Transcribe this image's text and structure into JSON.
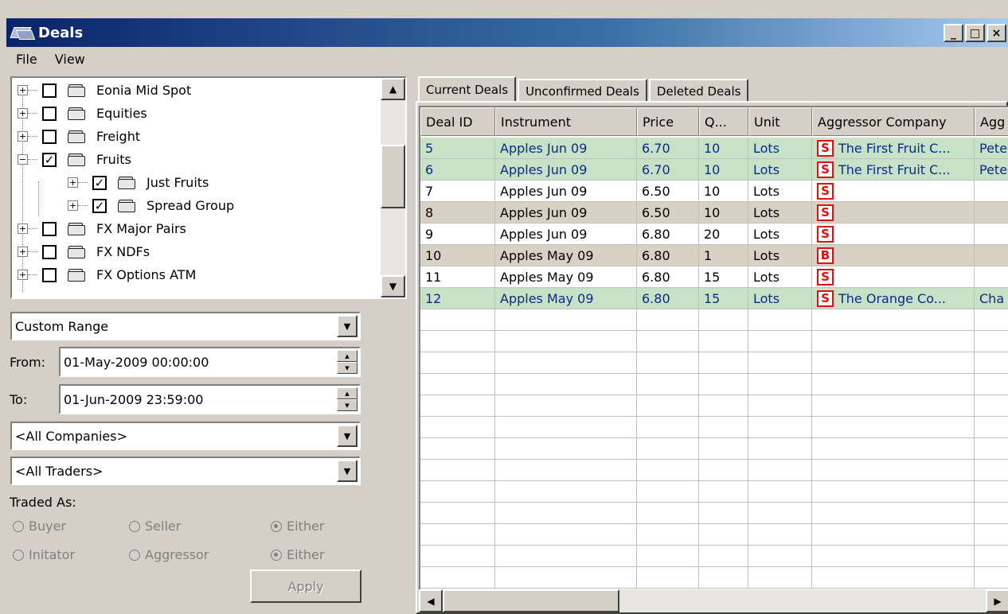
{
  "window": {
    "title": "Deals",
    "min_label": "_",
    "max_label": "□",
    "close_label": "×"
  },
  "menu": {
    "file": "File",
    "view": "View"
  },
  "tree": {
    "items": [
      {
        "label": "Eonia Mid Spot",
        "checked": false,
        "expander": "+"
      },
      {
        "label": "Equities",
        "checked": false,
        "expander": "+"
      },
      {
        "label": "Freight",
        "checked": false,
        "expander": "+"
      },
      {
        "label": "Fruits",
        "checked": true,
        "expander": "−"
      },
      {
        "label": "Just Fruits",
        "checked": true,
        "expander": "+"
      },
      {
        "label": "Spread Group",
        "checked": true,
        "expander": "+"
      },
      {
        "label": "FX Major Pairs",
        "checked": false,
        "expander": "+"
      },
      {
        "label": "FX NDFs",
        "checked": false,
        "expander": "+"
      },
      {
        "label": "FX Options ATM",
        "checked": false,
        "expander": "+"
      }
    ]
  },
  "filters": {
    "range": "Custom Range",
    "from_label": "From:",
    "from_value": "01-May-2009 00:00:00",
    "to_label": "To:",
    "to_value": "01-Jun-2009 23:59:00",
    "companies": "<All Companies>",
    "traders": "<All Traders>",
    "traded_as_label": "Traded As:",
    "radio_buyer": "Buyer",
    "radio_seller": "Seller",
    "radio_either1": "Either",
    "radio_initiator": "Initator",
    "radio_aggressor": "Aggressor",
    "radio_either2": "Either",
    "apply": "Apply"
  },
  "tabs": {
    "current": "Current Deals",
    "unconfirmed": "Unconfirmed Deals",
    "deleted": "Deleted Deals"
  },
  "table": {
    "headers": {
      "deal_id": "Deal ID",
      "instrument": "Instrument",
      "price": "Price",
      "qty": "Q...",
      "unit": "Unit",
      "aggressor_company": "Aggressor Company",
      "agg": "Agg"
    },
    "rows": [
      {
        "id": "5",
        "instrument": "Apples Jun 09",
        "price": "6.70",
        "qty": "10",
        "unit": "Lots",
        "side": "S",
        "company": "The First Fruit C...",
        "agg": "Pete"
      },
      {
        "id": "6",
        "instrument": "Apples Jun 09",
        "price": "6.70",
        "qty": "10",
        "unit": "Lots",
        "side": "S",
        "company": "The First Fruit C...",
        "agg": "Pete"
      },
      {
        "id": "7",
        "instrument": "Apples Jun 09",
        "price": "6.50",
        "qty": "10",
        "unit": "Lots",
        "side": "S",
        "company": "",
        "agg": ""
      },
      {
        "id": "8",
        "instrument": "Apples Jun 09",
        "price": "6.50",
        "qty": "10",
        "unit": "Lots",
        "side": "S",
        "company": "",
        "agg": ""
      },
      {
        "id": "9",
        "instrument": "Apples Jun 09",
        "price": "6.80",
        "qty": "20",
        "unit": "Lots",
        "side": "S",
        "company": "",
        "agg": ""
      },
      {
        "id": "10",
        "instrument": "Apples May 09",
        "price": "6.80",
        "qty": "1",
        "unit": "Lots",
        "side": "B",
        "company": "",
        "agg": ""
      },
      {
        "id": "11",
        "instrument": "Apples May 09",
        "price": "6.80",
        "qty": "15",
        "unit": "Lots",
        "side": "S",
        "company": "",
        "agg": ""
      },
      {
        "id": "12",
        "instrument": "Apples May 09",
        "price": "6.80",
        "qty": "15",
        "unit": "Lots",
        "side": "S",
        "company": "The Orange Co...",
        "agg": "Cha"
      }
    ]
  }
}
